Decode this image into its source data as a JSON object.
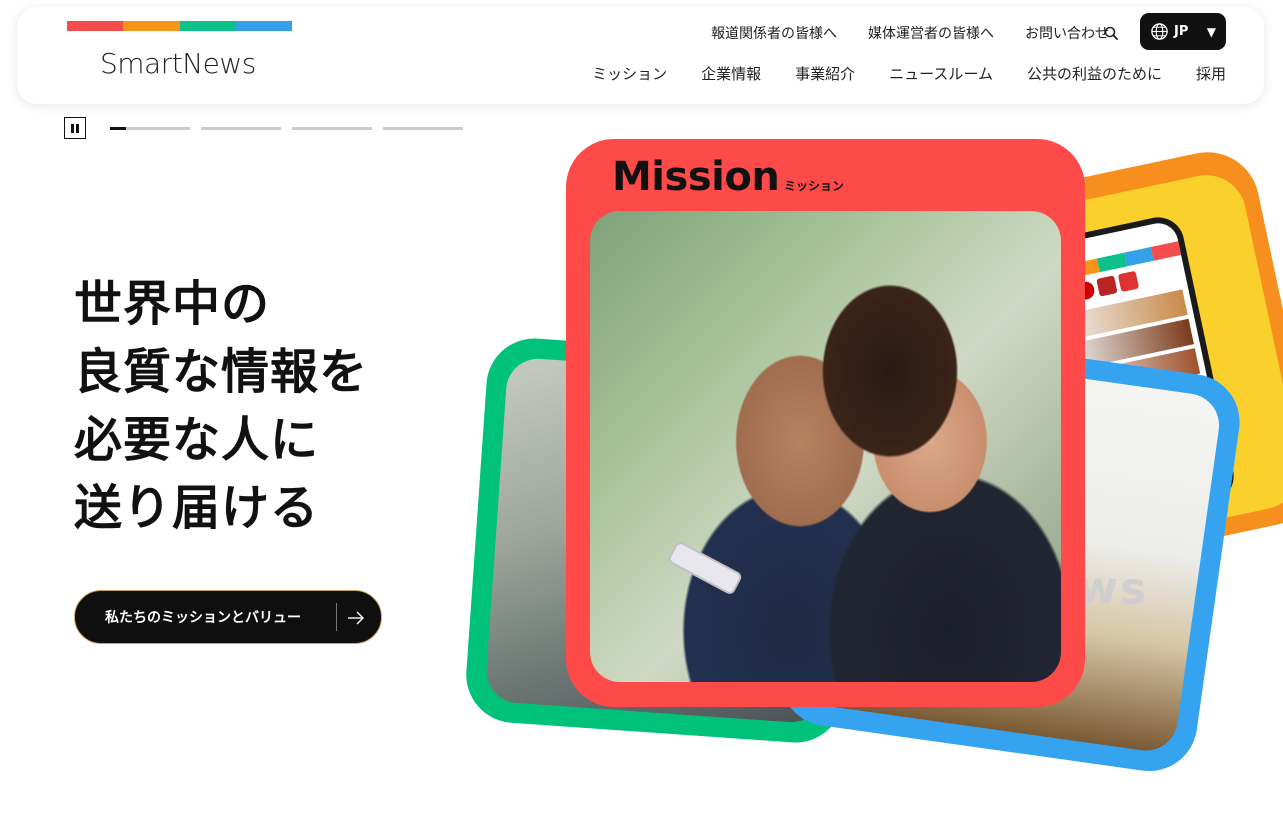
{
  "brand": {
    "name": "SmartNews",
    "bar_colors": [
      "#f34d4d",
      "#f79419",
      "#0dc28a",
      "#34a0e8"
    ]
  },
  "header": {
    "utility_links": [
      "報道関係者の皆様へ",
      "媒体運営者の皆様へ",
      "お問い合わせ"
    ],
    "search_icon": "search-icon",
    "language": "JP",
    "main_nav": [
      "ミッション",
      "企業情報",
      "事業紹介",
      "ニュースルーム",
      "公共の利益のために",
      "採用"
    ]
  },
  "slider": {
    "pause_icon": "pause-icon",
    "slides": 4,
    "active_index": 0,
    "active_progress": 0.2
  },
  "hero": {
    "headline_lines": [
      "世界中の",
      "良質な情報を",
      "必要な人に",
      "送り届ける"
    ],
    "cta_label": "私たちのミッションとバリュー",
    "cta_icon": "arrow-right-icon"
  },
  "collage": {
    "mission_title": "Mission",
    "mission_sub": "ミッション",
    "news_word": "ews",
    "colors": {
      "red": "#ff4a4a",
      "green": "#00c27a",
      "blue": "#36a3f0",
      "orange": "#f78f1e",
      "yellow": "#fad02c"
    }
  }
}
